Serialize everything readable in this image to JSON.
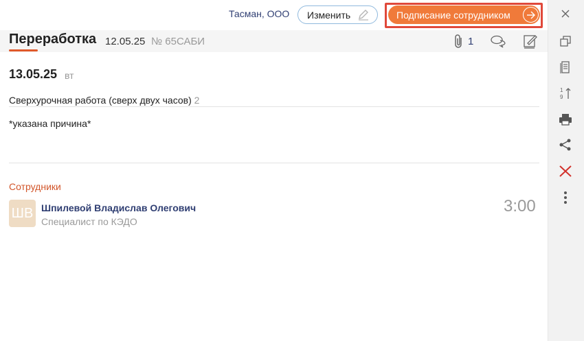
{
  "topbar": {
    "org": "Тасман, ООО",
    "edit_label": "Изменить",
    "sign_label": "Подписание сотрудником"
  },
  "header": {
    "title": "Переработка",
    "date": "12.05.25",
    "number": "№ 65САБИ",
    "attachments_count": "1"
  },
  "content": {
    "date": "13.05.25",
    "weekday": "вт",
    "reason": "Сверхурочная работа (сверх двух часов)",
    "reason_count": "2",
    "comment": "*указана причина*"
  },
  "employees": {
    "section_label": "Сотрудники",
    "items": [
      {
        "initials": "ШВ",
        "name": "Шпилевой Владислав Олегович",
        "role": "Специалист по КЭДО",
        "time": "3:00"
      }
    ]
  },
  "colors": {
    "accent": "#f07a3a",
    "highlight": "#e0483a",
    "link": "#2f3e72",
    "section": "#d2552a"
  },
  "rightbar_icons": [
    "close-icon",
    "copy-icon",
    "document-icon",
    "sort-icon",
    "print-icon",
    "share-icon",
    "delete-icon",
    "more-icon"
  ]
}
